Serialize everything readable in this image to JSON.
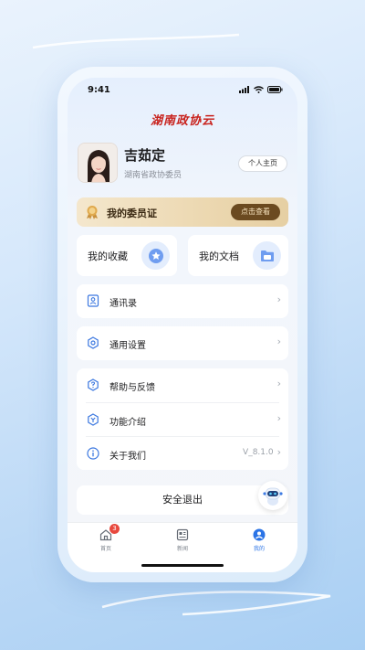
{
  "status_bar": {
    "time": "9:41"
  },
  "app": {
    "logo_text": "湖南政协云"
  },
  "profile": {
    "name": "吉茹定",
    "title": "湖南省政协委员",
    "home_button": "个人主页"
  },
  "member_card": {
    "label": "我的委员证",
    "button": "点击查看"
  },
  "quick_links": [
    {
      "label": "我的收藏",
      "icon": "star-icon"
    },
    {
      "label": "我的文档",
      "icon": "folder-icon"
    }
  ],
  "menu": {
    "contacts": "通讯录",
    "settings": "通用设置",
    "help": "帮助与反馈",
    "features": "功能介绍",
    "about": "关于我们",
    "version": "V_8.1.0"
  },
  "logout_label": "安全退出",
  "tabs": [
    {
      "label": "首页",
      "icon": "home-icon",
      "badge": "3"
    },
    {
      "label": "新闻",
      "icon": "news-icon"
    },
    {
      "label": "我的",
      "icon": "profile-icon",
      "active": true
    }
  ],
  "colors": {
    "accent": "#2b74e6",
    "brand_red": "#c8221d",
    "gold": "#6b4a20"
  }
}
